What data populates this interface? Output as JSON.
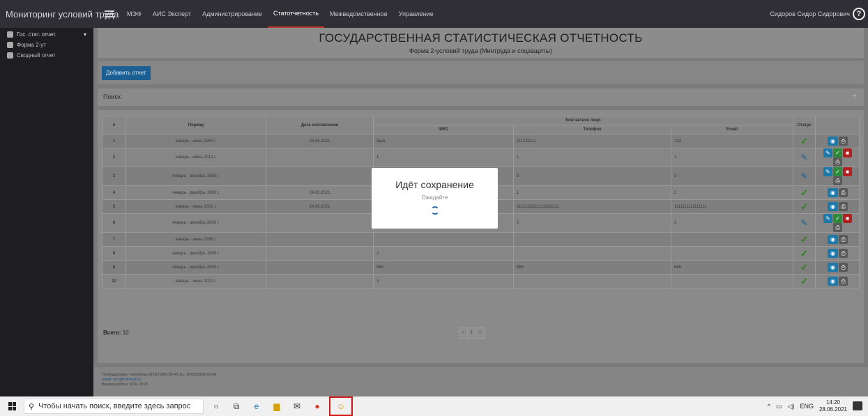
{
  "app": {
    "title": "Мониторинг условий труда",
    "user": "Сидоров Сидор Сидорович"
  },
  "nav": [
    {
      "label": "МЭФ",
      "active": false
    },
    {
      "label": "АИС Эксперт",
      "active": false
    },
    {
      "label": "Администрирование",
      "active": false
    },
    {
      "label": "Статотчетность",
      "active": true
    },
    {
      "label": "Межведомственное",
      "active": false
    },
    {
      "label": "Управление",
      "active": false
    }
  ],
  "sidebar": {
    "group": "Гос. стат. отчет.",
    "items": [
      "Форма 2-ут",
      "Сводный отчет"
    ]
  },
  "page": {
    "title": "ГОСУДАРСТВЕННАЯ СТАТИСТИЧЕСКАЯ ОТЧЕТНОСТЬ",
    "subtitle": "Форма 2-условий труда (Минтруда и соцзащиты)",
    "add_button": "Добавить отчет",
    "search_label": "Поиск"
  },
  "table": {
    "headers": {
      "num": "#",
      "period": "Период",
      "date": "Дата составления",
      "contact": "Контактное лицо",
      "fio": "ФИО",
      "phone": "Телефон",
      "email": "Email",
      "status": "Статус"
    },
    "rows": [
      {
        "num": "1",
        "period": "январь - июнь 1950 г.",
        "date": "28.06.2021",
        "fio": "фыв",
        "phone": "111222111",
        "email": "123",
        "editable": false
      },
      {
        "num": "2",
        "period": "январь - июнь 2012 г.",
        "date": "",
        "fio": "1",
        "phone": "1",
        "email": "1",
        "editable": true
      },
      {
        "num": "3",
        "period": "январь - декабрь 1980 г.",
        "date": "",
        "fio": "3",
        "phone": "3",
        "email": "3",
        "editable": true
      },
      {
        "num": "4",
        "period": "январь - декабрь 1990 г.",
        "date": "24.06.2021",
        "fio": "",
        "phone": "1",
        "email": "2",
        "editable": false
      },
      {
        "num": "5",
        "period": "январь - июнь 2002 г.",
        "date": "24.06.2021",
        "fio": "",
        "phone": "111111111111111111111",
        "email": "1111111111111111",
        "editable": false
      },
      {
        "num": "6",
        "period": "январь - декабрь 2006 г.",
        "date": "",
        "fio": "",
        "phone": "2",
        "email": "2",
        "editable": true
      },
      {
        "num": "7",
        "period": "январь - июнь 1996 г.",
        "date": "",
        "fio": "",
        "phone": "",
        "email": "",
        "editable": false
      },
      {
        "num": "8",
        "period": "январь - декабрь 1999 г.",
        "date": "",
        "fio": "2",
        "phone": "",
        "email": "",
        "editable": false
      },
      {
        "num": "9",
        "period": "январь - декабрь 2000 г.",
        "date": "",
        "fio": "666",
        "phone": "666",
        "email": "666",
        "editable": false
      },
      {
        "num": "10",
        "period": "январь - июнь 2021 г.",
        "date": "",
        "fio": "3",
        "phone": "",
        "email": "",
        "editable": false
      }
    ],
    "total_label": "Всего:",
    "total_value": "10",
    "pager": [
      "«",
      "1",
      "»"
    ]
  },
  "footer": {
    "support": "Техподдержка: телефоны (8-017)309-93-45 А1: (8-029)309-93-46",
    "email": "email: arm@mintrud.by",
    "hours": "Время работы: 9:00-18:00"
  },
  "modal": {
    "title": "Идёт сохранение",
    "subtitle": "Ожидайте"
  },
  "taskbar": {
    "search_placeholder": "Чтобы начать поиск, введите здесь запрос",
    "lang": "ENG",
    "time": "14:20",
    "date": "28.06.2021"
  }
}
